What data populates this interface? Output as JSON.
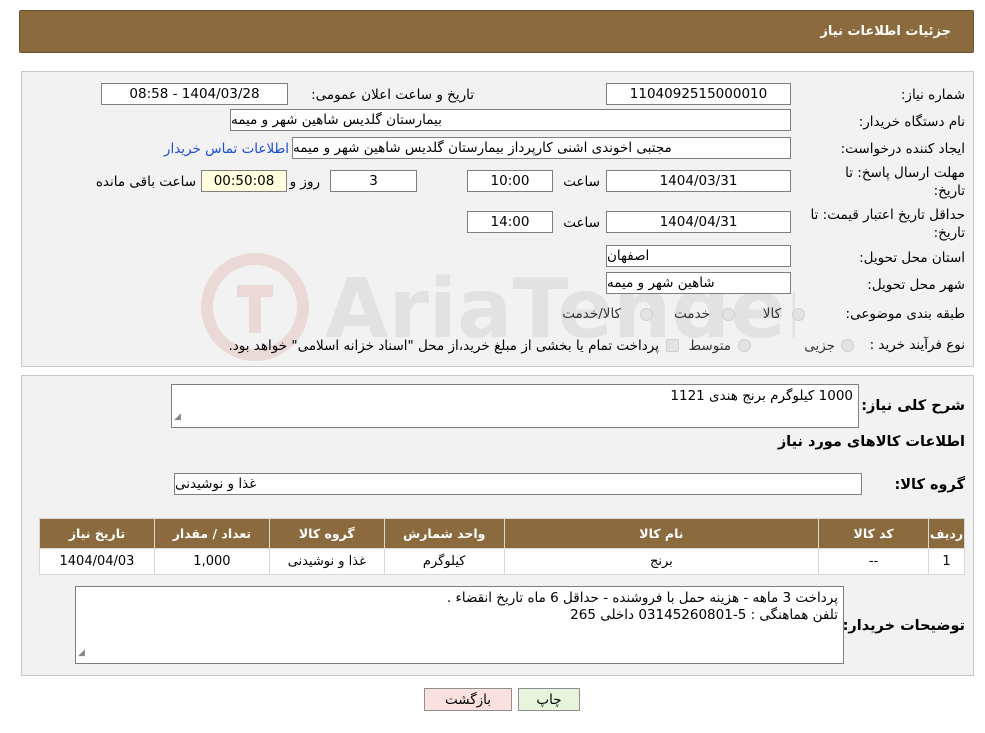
{
  "header": {
    "title": "جزئیات اطلاعات نیاز"
  },
  "form": {
    "need_number_label": "شماره نیاز:",
    "need_number": "1104092515000010",
    "announce_label": "تاریخ و ساعت اعلان عمومی:",
    "announce_value": "1404/03/28 - 08:58",
    "buyer_org_label": "نام دستگاه خریدار:",
    "buyer_org": "بیمارستان گلدیس  شاهین شهر و میمه",
    "creator_label": "ایجاد کننده درخواست:",
    "creator": "مجتبی اخوندی اشنی کارپرداز بیمارستان گلدیس  شاهین شهر و میمه",
    "contact_link": "اطلاعات تماس خریدار",
    "reply_deadline_label_1": "مهلت ارسال پاسخ: تا",
    "reply_deadline_label_2": "تاریخ:",
    "reply_date": "1404/03/31",
    "hour_label": "ساعت",
    "reply_time": "10:00",
    "days_value": "3",
    "days_label": "روز و",
    "remaining_time": "00:50:08",
    "remaining_label": "ساعت باقی مانده",
    "validity_label_1": "حداقل تاریخ اعتبار قیمت: تا",
    "validity_label_2": "تاریخ:",
    "validity_date": "1404/04/31",
    "validity_hour_label": "ساعت",
    "validity_time": "14:00",
    "province_label": "استان محل تحویل:",
    "province": "اصفهان",
    "city_label": "شهر محل تحویل:",
    "city": "شاهین شهر و میمه",
    "category_label": "طبقه بندی موضوعی:",
    "category_options": [
      "کالا",
      "خدمت",
      "کالا/خدمت"
    ],
    "process_label": "نوع فرآیند خرید :",
    "process_options": [
      "جزیی",
      "متوسط"
    ],
    "process_note": "پرداخت تمام یا بخشی از مبلغ خرید،از محل \"اسناد خزانه اسلامی\" خواهد بود."
  },
  "details": {
    "summary_label": "شرح کلی نیاز:",
    "summary": "1000 کیلوگرم برنج هندی 1121",
    "items_title": "اطلاعات کالاهای مورد نیاز",
    "group_label": "گروه کالا:",
    "group": "غذا و نوشیدنی",
    "table": {
      "headers": [
        "ردیف",
        "کد کالا",
        "نام کالا",
        "واحد شمارش",
        "گروه کالا",
        "تعداد / مقدار",
        "تاریخ نیاز"
      ],
      "rows": [
        [
          "1",
          "--",
          "برنج",
          "کیلوگرم",
          "غذا و نوشیدنی",
          "1,000",
          "1404/04/03"
        ]
      ]
    },
    "buyer_notes_label": "توضیحات خریدار:",
    "buyer_notes_line1": "پرداخت 3 ماهه - هزینه حمل با فروشنده - حداقل 6 ماه تاریخ انقضاء .",
    "buyer_notes_line2": "تلفن هماهنگی : 5-03145260801 داخلی 265"
  },
  "buttons": {
    "back": "بازگشت",
    "print": "چاپ"
  },
  "watermark": {
    "text": "AriaTender.neT"
  },
  "colors": {
    "header": "#8b6a3e",
    "link": "#1a4ed8",
    "time_box": "#ffffde"
  }
}
